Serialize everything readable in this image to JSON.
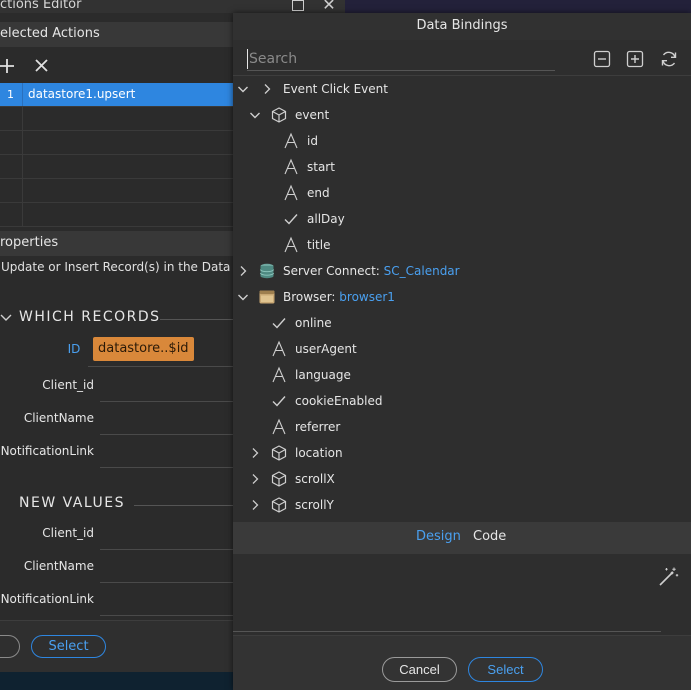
{
  "actions_editor": {
    "title": "ctions Editor",
    "selected_actions_title": "elected Actions",
    "rows": [
      {
        "num": "1",
        "value": "datastore1.upsert",
        "selected": true
      },
      {
        "num": "",
        "value": "",
        "selected": false
      },
      {
        "num": "",
        "value": "",
        "selected": false
      },
      {
        "num": "",
        "value": "",
        "selected": false
      },
      {
        "num": "",
        "value": "",
        "selected": false
      },
      {
        "num": "",
        "value": "",
        "selected": false
      }
    ],
    "properties_title": "roperties",
    "description": "Update or Insert Record(s) in the Data Sto",
    "which_records": {
      "title": "WHICH RECORDS",
      "id_label": "ID",
      "id_value": "datastore..$id",
      "fields": [
        "Client_id",
        "ClientName",
        "NotificationLink"
      ]
    },
    "new_values": {
      "title": "NEW VALUES",
      "fields": [
        "Client_id",
        "ClientName",
        "NotificationLink"
      ]
    },
    "select_label": "Select"
  },
  "data_bindings": {
    "title": "Data Bindings",
    "search_placeholder": "Search",
    "tools": [
      "collapse-all-icon",
      "expand-all-icon",
      "refresh-icon"
    ],
    "tree": [
      {
        "label": "Event Click Event",
        "icon": "",
        "chevron": "down",
        "level": 0
      },
      {
        "label": "event",
        "icon": "cube",
        "chevron": "down",
        "level": 1
      },
      {
        "label": "id",
        "icon": "text",
        "chevron": "",
        "level": 2
      },
      {
        "label": "start",
        "icon": "text",
        "chevron": "",
        "level": 2
      },
      {
        "label": "end",
        "icon": "text",
        "chevron": "",
        "level": 2
      },
      {
        "label": "allDay",
        "icon": "check",
        "chevron": "",
        "level": 2
      },
      {
        "label": "title",
        "icon": "text",
        "chevron": "",
        "level": 2
      },
      {
        "label": "Server Connect: ",
        "link": "SC_Calendar",
        "icon": "database",
        "chevron": "right",
        "level": 0
      },
      {
        "label": "Browser: ",
        "link": "browser1",
        "icon": "browser",
        "chevron": "down",
        "level": 0
      },
      {
        "label": "online",
        "icon": "check",
        "chevron": "",
        "level": 1
      },
      {
        "label": "userAgent",
        "icon": "text",
        "chevron": "",
        "level": 1
      },
      {
        "label": "language",
        "icon": "text",
        "chevron": "",
        "level": 1
      },
      {
        "label": "cookieEnabled",
        "icon": "check",
        "chevron": "",
        "level": 1
      },
      {
        "label": "referrer",
        "icon": "text",
        "chevron": "",
        "level": 1
      },
      {
        "label": "location",
        "icon": "cube",
        "chevron": "right",
        "level": 1
      },
      {
        "label": "scrollX",
        "icon": "cube",
        "chevron": "right",
        "level": 1
      },
      {
        "label": "scrollY",
        "icon": "cube",
        "chevron": "right",
        "level": 1
      }
    ],
    "tabs": {
      "design": "Design",
      "code": "Code"
    },
    "cancel_label": "Cancel",
    "select_label": "Select"
  },
  "colors": {
    "accent": "#2e86e0",
    "token": "#d9883a"
  }
}
